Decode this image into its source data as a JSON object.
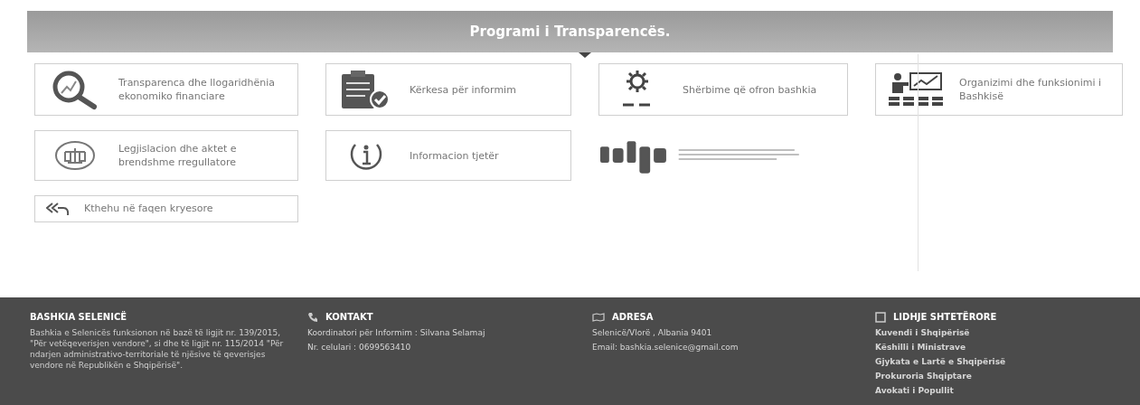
{
  "banner": {
    "title": "Programi i Transparencës."
  },
  "cards": [
    {
      "kind": "magnifier",
      "text": "Transparenca dhe llogaridhënia ekonomiko financiare"
    },
    {
      "kind": "clipboard",
      "text": "Kërkesa për informim"
    },
    {
      "kind": "gear",
      "text": "Shërbime që ofron bashkia"
    },
    {
      "kind": "presentation",
      "text": "Organizimi dhe funksionimi i Bashkisë"
    },
    {
      "kind": "law",
      "text": "Legjislacion dhe aktet e brendshme rregullatore"
    },
    {
      "kind": "info",
      "text": "Informacion tjetër"
    },
    {
      "kind": "logo"
    }
  ],
  "back_link": {
    "text": "Kthehu në faqen kryesore"
  },
  "footer": [
    {
      "kind": "about",
      "heading": "BASHKIA SELENICË",
      "lines": [
        "Bashkia e Selenicës funksionon në bazë të ligjit nr. 139/2015, \"Për vetëqeverisjen vendore\", si dhe të ligjit nr. 115/2014 \"Për ndarjen administrativo-territoriale të njësive të qeverisjes vendore në Republikën e Shqipërisë\"."
      ]
    },
    {
      "kind": "phone",
      "heading": "KONTAKT",
      "lines": [
        "Koordinatori për Informim : Silvana Selamaj",
        "Nr. celulari : 0699563410"
      ]
    },
    {
      "kind": "map",
      "heading": "ADRESA",
      "lines": [
        "Selenicë/Vlorë , Albania 9401",
        "Email: bashkia.selenice@gmail.com"
      ]
    },
    {
      "kind": "links",
      "heading": "LIDHJE SHTETËRORE",
      "lines": [
        "Kuvendi i Shqipërisë",
        "Këshilli i Ministrave",
        "Gjykata e Lartë e Shqipërisë",
        "Prokuroria Shqiptare",
        "Avokati i Popullit"
      ]
    }
  ]
}
